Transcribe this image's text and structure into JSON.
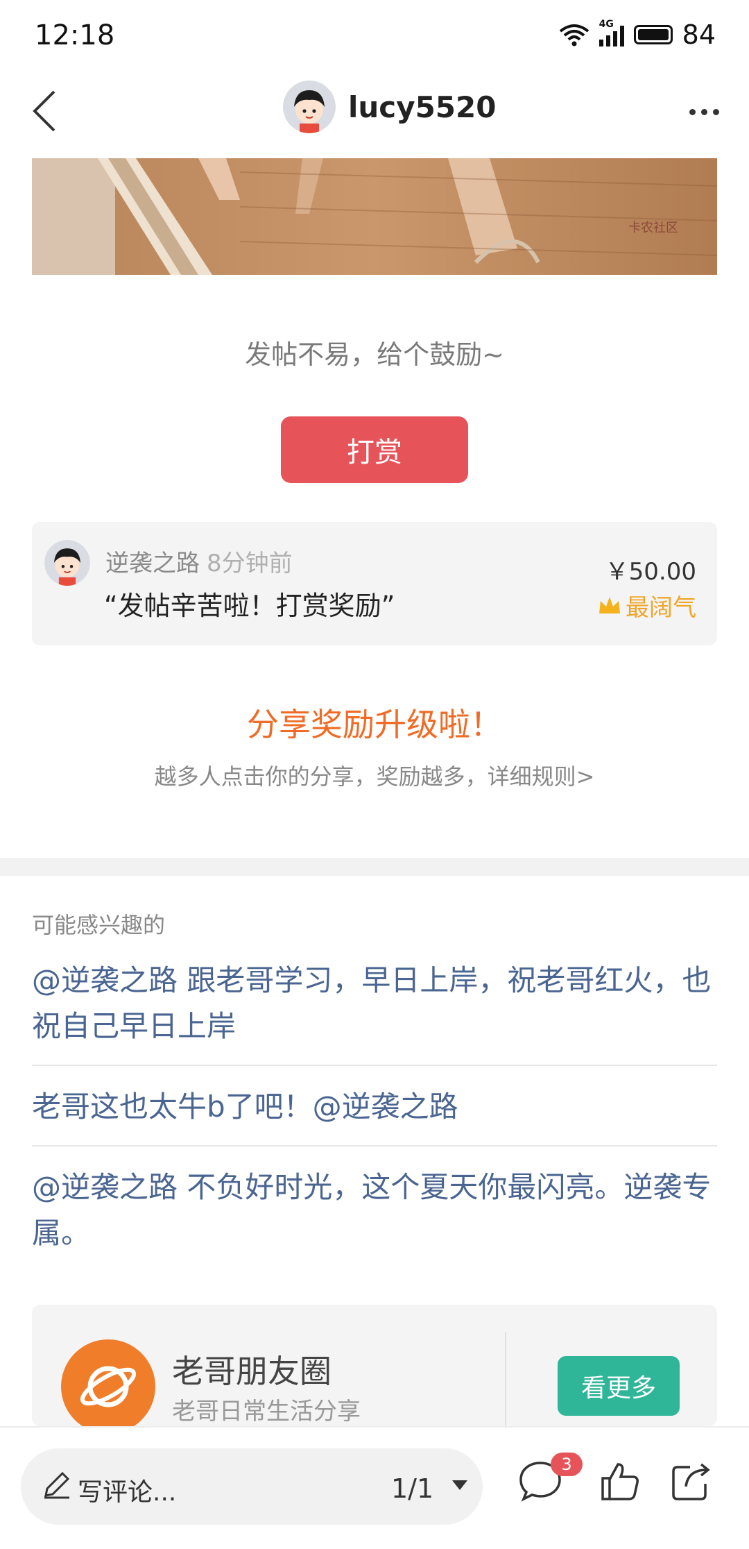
{
  "status_bar": {
    "time": "12:18",
    "network": "4G",
    "battery": "84"
  },
  "nav": {
    "username": "lucy5520",
    "icons": [
      "back-icon",
      "more-icon"
    ]
  },
  "post_image": {
    "watermark": "卡农社区"
  },
  "reward": {
    "prompt": "发帖不易，给个鼓励~",
    "button_label": "打赏",
    "record": {
      "name": "逆袭之路",
      "time": "8分钟前",
      "message": "“发帖辛苦啦！打赏奖励”",
      "amount": "￥50.00",
      "badge": "最阔气"
    }
  },
  "share": {
    "title": "分享奖励升级啦！",
    "description": "越多人点击你的分享，奖励越多，详细规则>"
  },
  "interest": {
    "header": "可能感兴趣的",
    "items": [
      "@逆袭之路 跟老哥学习，早日上岸，祝老哥红火，也祝自己早日上岸",
      "老哥这也太牛b了吧！@逆袭之路",
      "@逆袭之路 不负好时光，这个夏天你最闪亮。逆袭专属。"
    ]
  },
  "circle": {
    "name": "老哥朋友圈",
    "description": "老哥日常生活分享",
    "button_label": "看更多"
  },
  "bottom_bar": {
    "comment_placeholder": "写评论...",
    "page_indicator": "1/1",
    "comment_count": "3"
  },
  "colors": {
    "accent_red": "#e6545a",
    "share_orange": "#f06b25",
    "link_blue": "#4a6591",
    "circle_green": "#2fb598",
    "badge_gold": "#f0a52a"
  }
}
